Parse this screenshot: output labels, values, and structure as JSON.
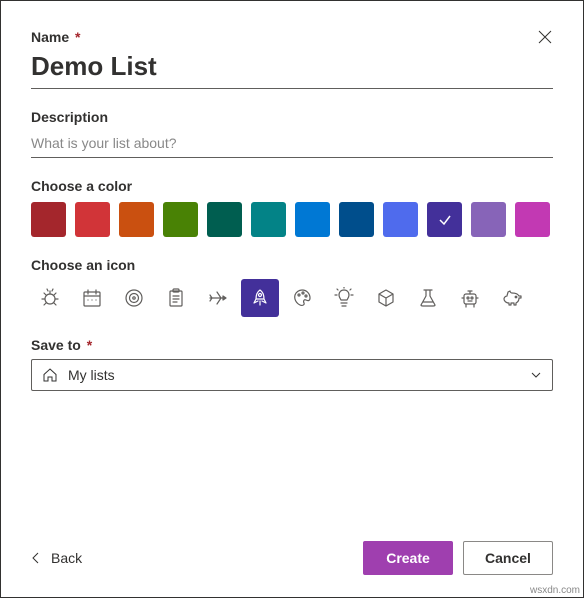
{
  "name": {
    "label": "Name",
    "required": "*",
    "value": "Demo List"
  },
  "description": {
    "label": "Description",
    "placeholder": "What is your list about?",
    "value": ""
  },
  "color_section": {
    "label": "Choose a color",
    "colors": [
      "#a4262c",
      "#d13438",
      "#ca5010",
      "#498205",
      "#005e50",
      "#038387",
      "#0078d4",
      "#004e8c",
      "#4f6bed",
      "#43309a",
      "#8764b8",
      "#c239b3"
    ],
    "selected_index": 9
  },
  "icon_section": {
    "label": "Choose an icon",
    "icons": [
      "bug-icon",
      "calendar-icon",
      "target-icon",
      "clipboard-icon",
      "airplane-icon",
      "rocket-icon",
      "palette-icon",
      "lightbulb-icon",
      "cube-icon",
      "flask-icon",
      "robot-icon",
      "piggybank-icon"
    ],
    "selected_index": 5
  },
  "save_to": {
    "label": "Save to",
    "required": "*",
    "value": "My lists"
  },
  "footer": {
    "back": "Back",
    "create": "Create",
    "cancel": "Cancel"
  },
  "watermark": "wsxdn.com"
}
